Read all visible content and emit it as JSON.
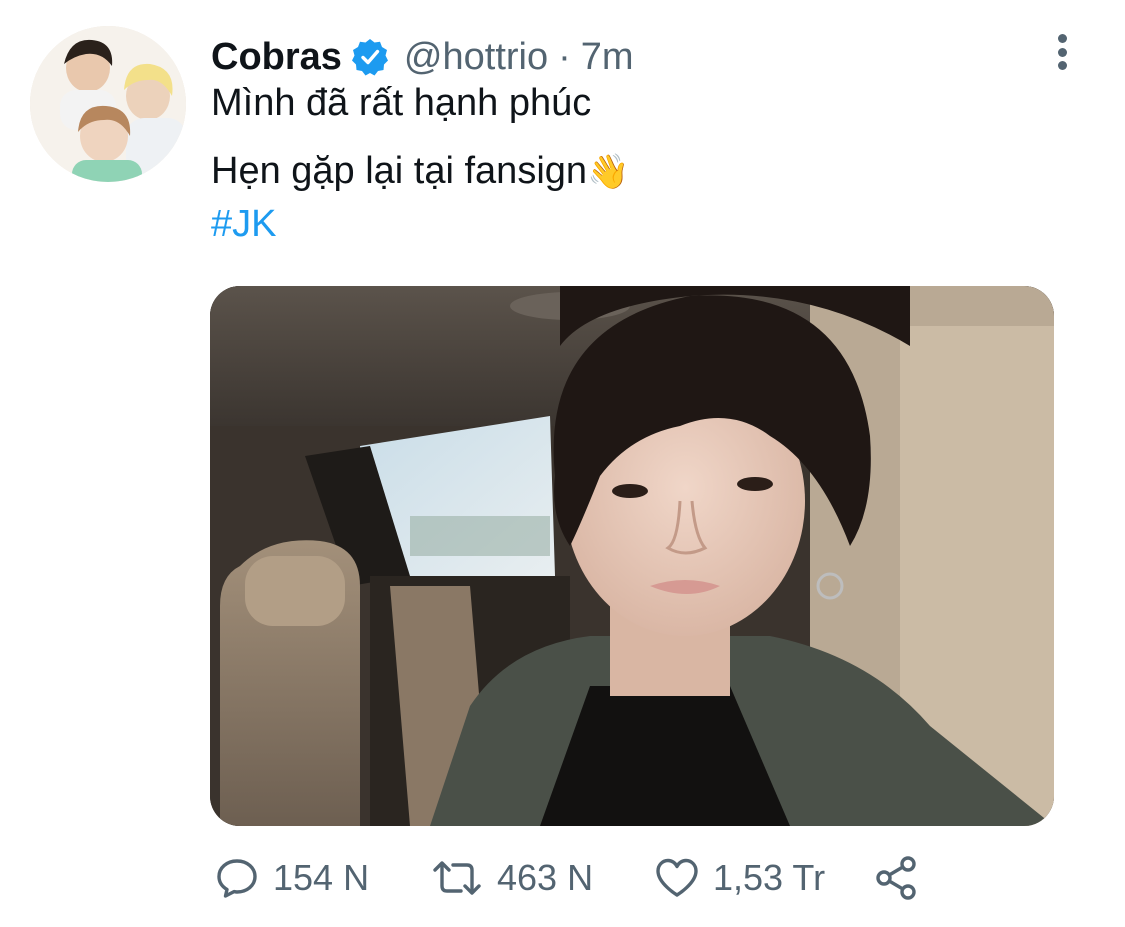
{
  "tweet": {
    "author": {
      "display_name": "Cobras",
      "verified_icon": "verified-badge-icon",
      "handle": "@hottrio",
      "separator": "·",
      "time": "7m"
    },
    "text_line1": "Mình đã rất hạnh phúc",
    "text_line2": "Hẹn gặp lại tại fansign",
    "emoji": "👋",
    "hashtag": "#JK",
    "actions": {
      "reply_count": "154 N",
      "retweet_count": "463 N",
      "like_count": "1,53 Tr"
    }
  },
  "icons": {
    "more": "more-vertical-icon",
    "reply": "reply-bubble-icon",
    "retweet": "retweet-icon",
    "like": "heart-icon",
    "share": "share-icon"
  },
  "colors": {
    "link": "#1d9bf0",
    "verified": "#1d9bf0",
    "secondary_text": "#536471",
    "primary_text": "#0f1419"
  }
}
